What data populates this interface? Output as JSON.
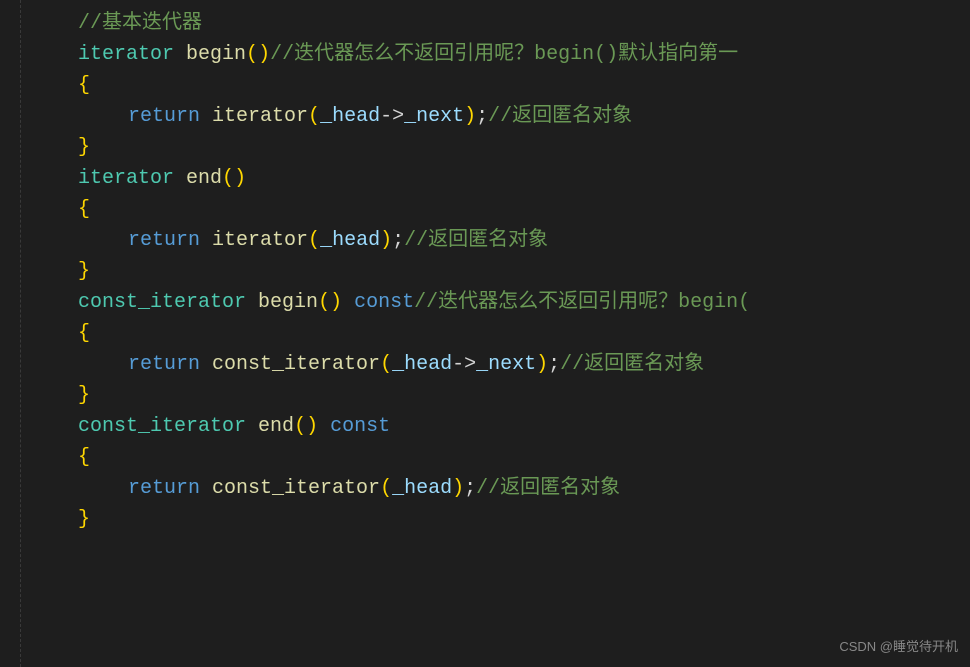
{
  "indent1": "    ",
  "indent2": "        ",
  "code": {
    "c1": "//基本迭代器",
    "type_iter": "iterator",
    "type_const_iter": "const_iterator",
    "fn_begin": "begin",
    "fn_end": "end",
    "paren_open": "(",
    "paren_close": ")",
    "brace_open": "{",
    "brace_close": "}",
    "kw_return": "return",
    "kw_const": "const",
    "ctor_iter": "iterator",
    "ctor_const_iter": "const_iterator",
    "member_head": "_head",
    "arrow": "->",
    "member_next": "_next",
    "semi": ";",
    "c2": "//迭代器怎么不返回引用呢？begin()默认指向第一",
    "c3": "//返回匿名对象",
    "c4": "//返回匿名对象",
    "c5": "//迭代器怎么不返回引用呢？begin(",
    "c6": "//返回匿名对象",
    "c7": "//返回匿名对象",
    "sp": " "
  },
  "watermark": "CSDN @睡觉待开机"
}
